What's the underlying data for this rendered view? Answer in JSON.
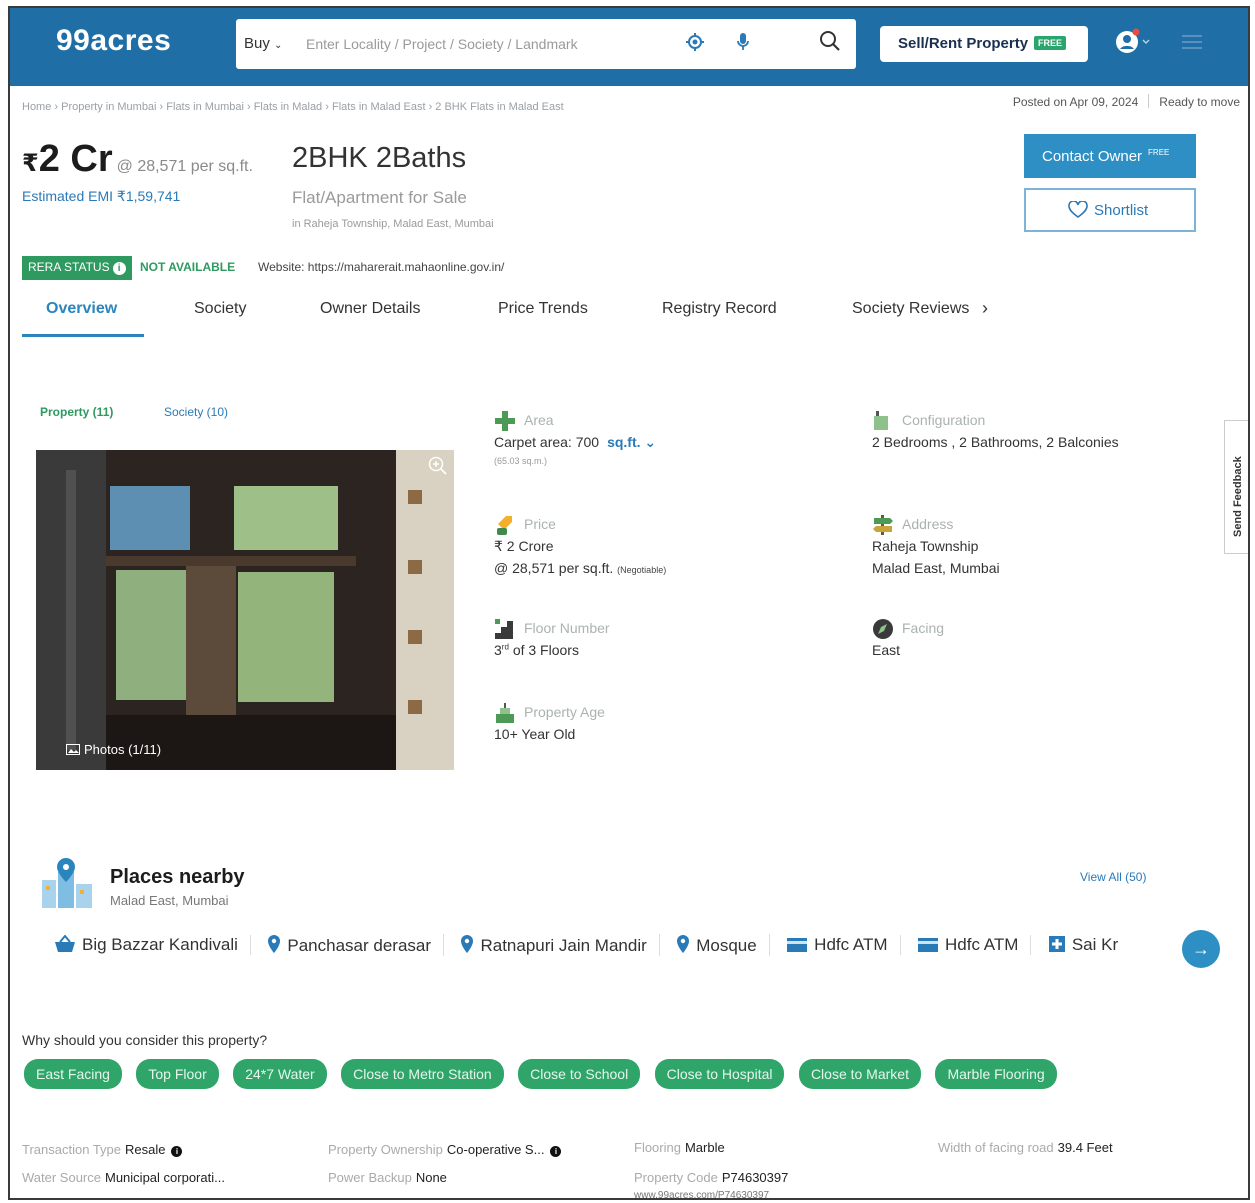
{
  "header": {
    "logo": "99acres",
    "buy_label": "Buy",
    "search_placeholder": "Enter Locality / Project / Society / Landmark",
    "sell_label": "Sell/Rent Property",
    "free_tag": "FREE"
  },
  "breadcrumb": [
    "Home",
    "Property in Mumbai",
    "Flats in Mumbai",
    "Flats in Malad",
    "Flats in Malad East",
    "2 BHK Flats in Malad East"
  ],
  "posted": "Posted on Apr 09, 2024",
  "availability": "Ready to move",
  "listing": {
    "currency": "₹",
    "price": "2 Cr",
    "rate": "@ 28,571 per sq.ft.",
    "emi": "Estimated EMI ₹1,59,741",
    "title": "2BHK 2Baths",
    "subtitle": "Flat/Apartment for Sale",
    "locality": "in Raheja Township, Malad East, Mumbai"
  },
  "actions": {
    "contact_label": "Contact Owner",
    "contact_tag": "FREE",
    "shortlist_label": "Shortlist"
  },
  "rera": {
    "label": "RERA STATUS",
    "value": "NOT AVAILABLE",
    "website": "Website: https://maharerait.mahaonline.gov.in/"
  },
  "tabs": [
    "Overview",
    "Society",
    "Owner Details",
    "Price Trends",
    "Registry Record",
    "Society Reviews"
  ],
  "subtabs": {
    "property": "Property (11)",
    "society": "Society (10)"
  },
  "photo": {
    "label": "Photos (1/11)"
  },
  "details": {
    "area": {
      "label": "Area",
      "value": "Carpet area: 700",
      "unit": "sq.ft.",
      "sub": "(65.03 sq.m.)"
    },
    "configuration": {
      "label": "Configuration",
      "value": "2 Bedrooms , 2 Bathrooms, 2 Balconies"
    },
    "price": {
      "label": "Price",
      "value": "₹ 2 Crore",
      "rate": "@ 28,571 per sq.ft.",
      "note": "(Negotiable)"
    },
    "address": {
      "label": "Address",
      "line1": "Raheja Township",
      "line2": "Malad East, Mumbai"
    },
    "floor": {
      "label": "Floor Number",
      "num": "3",
      "suffix": "rd",
      "rest": "of 3 Floors"
    },
    "facing": {
      "label": "Facing",
      "value": "East"
    },
    "age": {
      "label": "Property Age",
      "value": "10+ Year Old"
    }
  },
  "feedback_label": "Send Feedback",
  "places": {
    "title": "Places nearby",
    "subtitle": "Malad East, Mumbai",
    "view_all": "View All (50)",
    "items": [
      {
        "name": "Big Bazzar Kandivali",
        "icon": "shopping-basket-icon"
      },
      {
        "name": "Panchasar derasar",
        "icon": "location-pin-icon"
      },
      {
        "name": "Ratnapuri Jain Mandir",
        "icon": "location-pin-icon"
      },
      {
        "name": "Mosque",
        "icon": "location-pin-icon"
      },
      {
        "name": "Hdfc ATM",
        "icon": "atm-card-icon"
      },
      {
        "name": "Hdfc ATM",
        "icon": "atm-card-icon"
      },
      {
        "name": "Sai Kr",
        "icon": "hospital-cross-icon"
      }
    ]
  },
  "why": {
    "title": "Why should you consider this property?",
    "chips": [
      "East Facing",
      "Top Floor",
      "24*7 Water",
      "Close to Metro Station",
      "Close to School",
      "Close to Hospital",
      "Close to Market",
      "Marble Flooring"
    ]
  },
  "facts": {
    "transaction": {
      "k": "Transaction Type",
      "v": "Resale"
    },
    "ownership": {
      "k": "Property Ownership",
      "v": "Co-operative S..."
    },
    "flooring": {
      "k": "Flooring",
      "v": "Marble"
    },
    "road": {
      "k": "Width of facing road",
      "v": "39.4 Feet"
    },
    "water": {
      "k": "Water Source",
      "v": "Municipal corporati..."
    },
    "power": {
      "k": "Power Backup",
      "v": "None"
    },
    "code": {
      "k": "Property Code",
      "v": "P74630397",
      "url": "www.99acres.com/P74630397"
    }
  },
  "colors": {
    "brand_blue": "#1f6fa6",
    "accent_green": "#2fa56a",
    "link_blue": "#2a7ab8"
  }
}
